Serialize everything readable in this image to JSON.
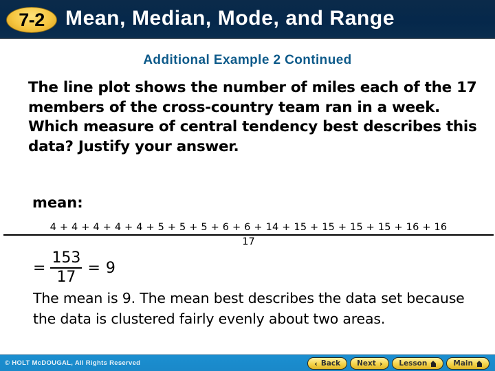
{
  "header": {
    "lesson_number": "7-2",
    "title": "Mean, Median, Mode, and Range"
  },
  "subtitle": "Additional Example 2 Continued",
  "problem": {
    "text": "The line plot shows the number of miles each of the 17 members of the cross-country team ran in a week. Which measure of central tendency best describes this data? Justify your answer."
  },
  "work": {
    "label": "mean:",
    "sum_expression": "4 + 4 + 4 + 4 + 4 + 5 + 5 + 5 + 6 + 6 + 14 + 15 + 15 + 15 + 15 + 16 + 16",
    "sum_denominator": "17",
    "equals_sign": "=",
    "fraction_numerator": "153",
    "fraction_denominator": "17",
    "result_equals": "=",
    "result_value": "9",
    "data_values": [
      4,
      4,
      4,
      4,
      4,
      5,
      5,
      5,
      6,
      6,
      14,
      15,
      15,
      15,
      15,
      16,
      16
    ]
  },
  "explanation": "The mean is 9. The mean best describes the data set because the data is clustered fairly evenly about two areas.",
  "footer": {
    "copyright": "© HOLT McDOUGAL, All Rights Reserved",
    "nav": {
      "back_label": "Back",
      "next_label": "Next",
      "lesson_label": "Lesson",
      "main_label": "Main"
    }
  },
  "colors": {
    "header_bg": "#05284b",
    "badge_yellow": "#f6c640",
    "subtitle_blue": "#0d5a8a",
    "footer_blue": "#1b8fd0",
    "button_yellow": "#f5d44a"
  }
}
